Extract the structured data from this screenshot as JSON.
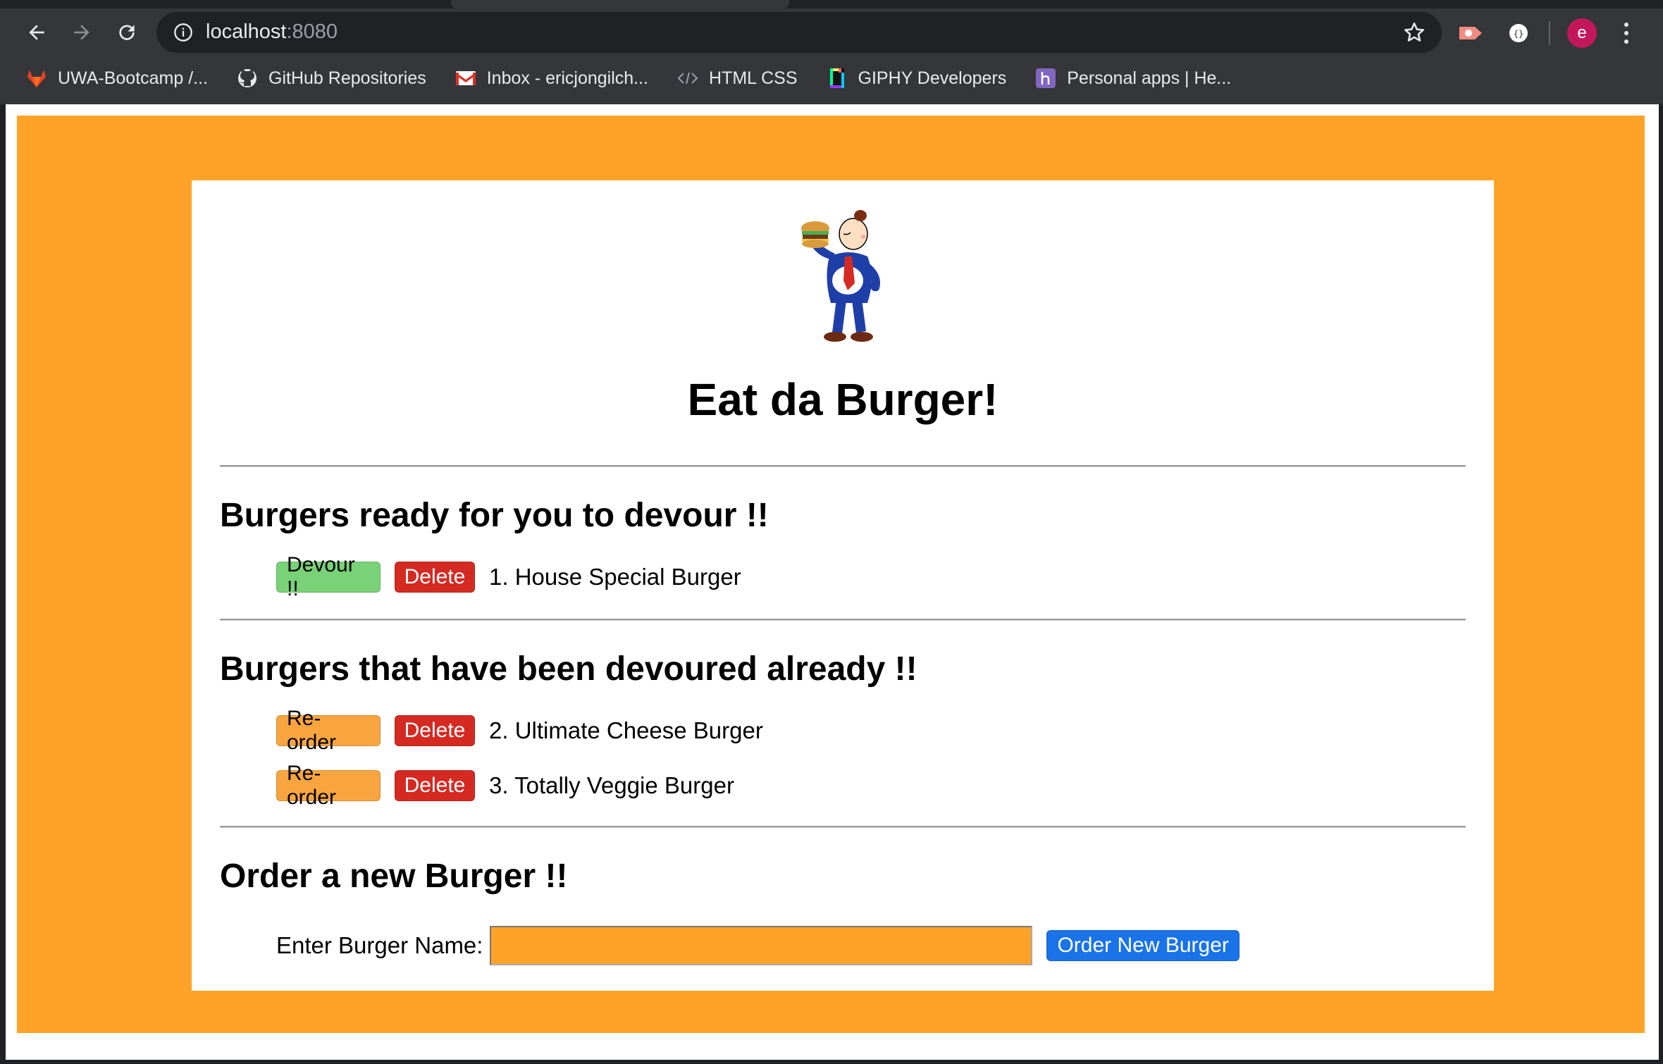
{
  "browser": {
    "url_host": "localhost",
    "url_port": ":8080",
    "profile_initial": "e",
    "bookmarks": [
      {
        "label": "UWA-Bootcamp /...",
        "icon": "gitlab-icon"
      },
      {
        "label": "GitHub Repositories",
        "icon": "github-icon"
      },
      {
        "label": "Inbox - ericjongilch...",
        "icon": "gmail-icon"
      },
      {
        "label": "HTML CSS",
        "icon": "code-icon"
      },
      {
        "label": "GIPHY Developers",
        "icon": "giphy-icon"
      },
      {
        "label": "Personal apps | He...",
        "icon": "heroku-icon"
      }
    ]
  },
  "page": {
    "title": "Eat da Burger!",
    "logo": "wimpy-burger-logo",
    "ready_section": {
      "title": "Burgers ready for you to devour !!",
      "items": [
        {
          "devour_label": "Devour !!",
          "delete_label": "Delete",
          "text": "1. House Special Burger"
        }
      ]
    },
    "devoured_section": {
      "title": "Burgers that have been devoured already !!",
      "items": [
        {
          "reorder_label": "Re-order",
          "delete_label": "Delete",
          "text": "2. Ultimate Cheese Burger"
        },
        {
          "reorder_label": "Re-order",
          "delete_label": "Delete",
          "text": "3. Totally Veggie Burger"
        }
      ]
    },
    "order_section": {
      "title": "Order a new Burger !!",
      "input_label": "Enter Burger Name:",
      "input_value": "",
      "submit_label": "Order New Burger"
    }
  },
  "colors": {
    "page_background": "#fea328",
    "devour_button": "#79d277",
    "reorder_button": "#f8a540",
    "delete_button": "#d42a22",
    "order_button": "#1a73e8"
  }
}
